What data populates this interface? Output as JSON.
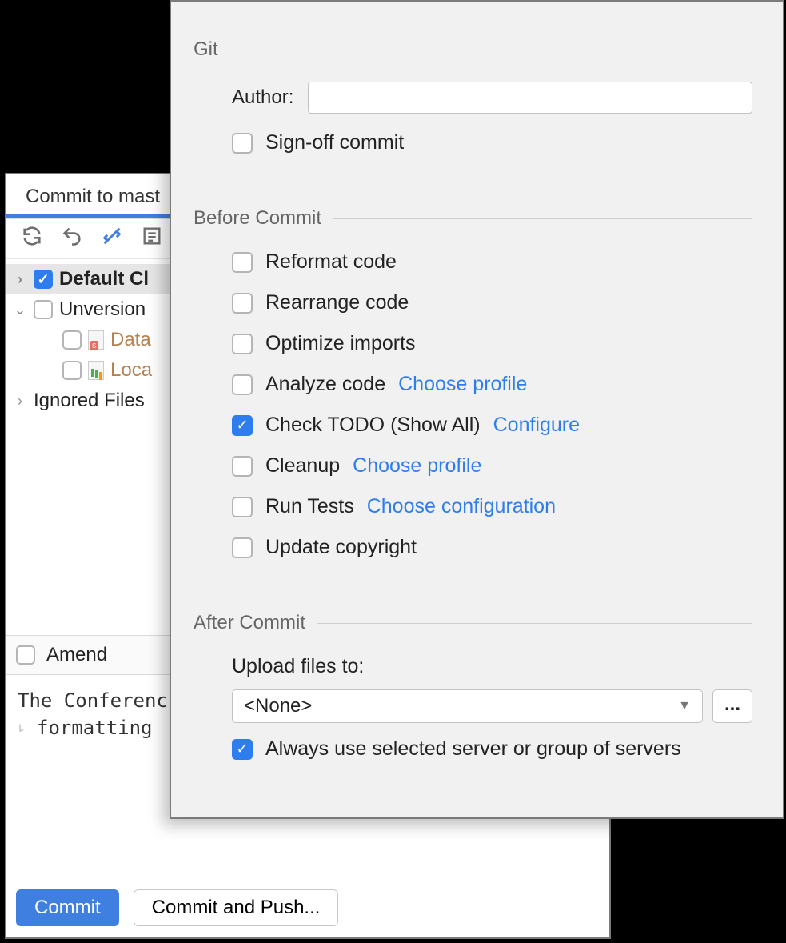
{
  "commit_panel": {
    "tab_title": "Commit to mast",
    "tree": {
      "default_changelist": "Default Cl",
      "default_checked": true,
      "unversioned": {
        "label": "Unversion",
        "files": [
          {
            "name": "Data",
            "icon": "s"
          },
          {
            "name": "Loca",
            "icon": "chart"
          }
        ]
      },
      "ignored_label": "Ignored Files"
    },
    "amend_label": "Amend",
    "commit_message_line1": "The Conferenc",
    "commit_message_line2": "formatting",
    "buttons": {
      "commit": "Commit",
      "commit_and_push": "Commit and Push..."
    }
  },
  "popup": {
    "git": {
      "title": "Git",
      "author_label": "Author:",
      "author_value": "",
      "sign_off": {
        "label": "Sign-off commit",
        "checked": false
      }
    },
    "before": {
      "title": "Before Commit",
      "items": [
        {
          "label": "Reformat code",
          "checked": false
        },
        {
          "label": "Rearrange code",
          "checked": false
        },
        {
          "label": "Optimize imports",
          "checked": false
        },
        {
          "label": "Analyze code",
          "checked": false,
          "link": "Choose profile"
        },
        {
          "label": "Check TODO (Show All)",
          "checked": true,
          "link": "Configure"
        },
        {
          "label": "Cleanup",
          "checked": false,
          "link": "Choose profile"
        },
        {
          "label": "Run Tests",
          "checked": false,
          "link": "Choose configuration"
        },
        {
          "label": "Update copyright",
          "checked": false
        }
      ]
    },
    "after": {
      "title": "After Commit",
      "upload_label": "Upload files to:",
      "upload_value": "<None>",
      "always_use": {
        "label": "Always use selected server or group of servers",
        "checked": true
      }
    }
  }
}
